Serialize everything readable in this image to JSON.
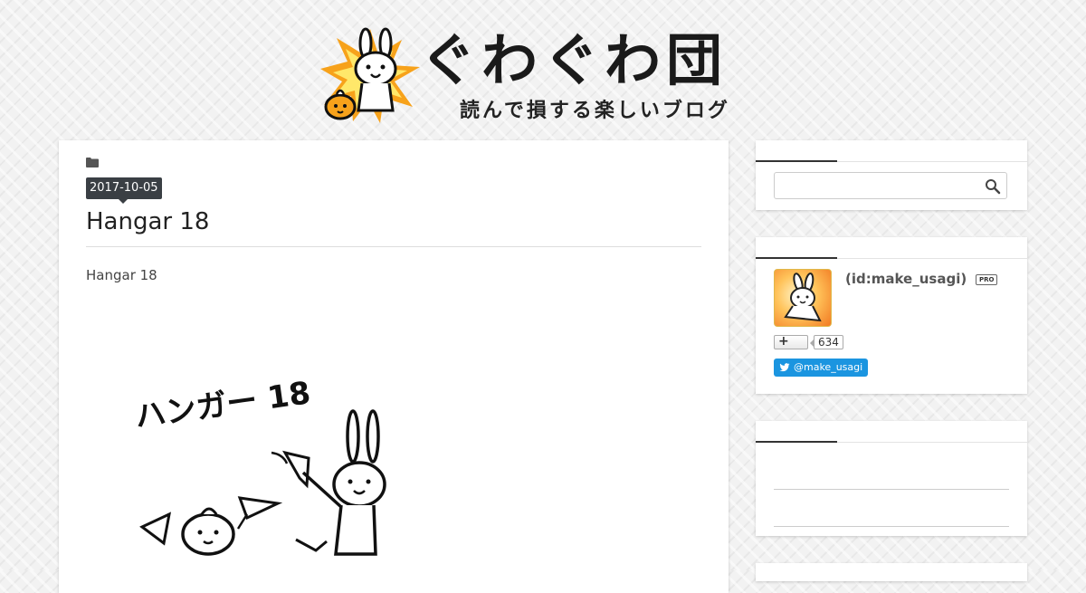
{
  "site": {
    "title": "ぐわぐわ団",
    "tagline": "読んで損する楽しいブログ"
  },
  "article": {
    "date": "2017-10-05",
    "title": "Hangar 18",
    "body_text": "Hangar 18",
    "illustration_caption": "ハンガー 18"
  },
  "sidebar": {
    "search": {
      "placeholder": "",
      "value": ""
    },
    "profile": {
      "user_id": "(id:make_usagi)",
      "pro_badge": "PRO",
      "follow_label": "+",
      "follow_count": "634",
      "twitter_label": "@make_usagi"
    }
  },
  "colors": {
    "background": "#f2f2f2",
    "card": "#ffffff",
    "date_badge": "#3a3f44",
    "twitter": "#1b95e0",
    "accent_rule": "#333333"
  }
}
